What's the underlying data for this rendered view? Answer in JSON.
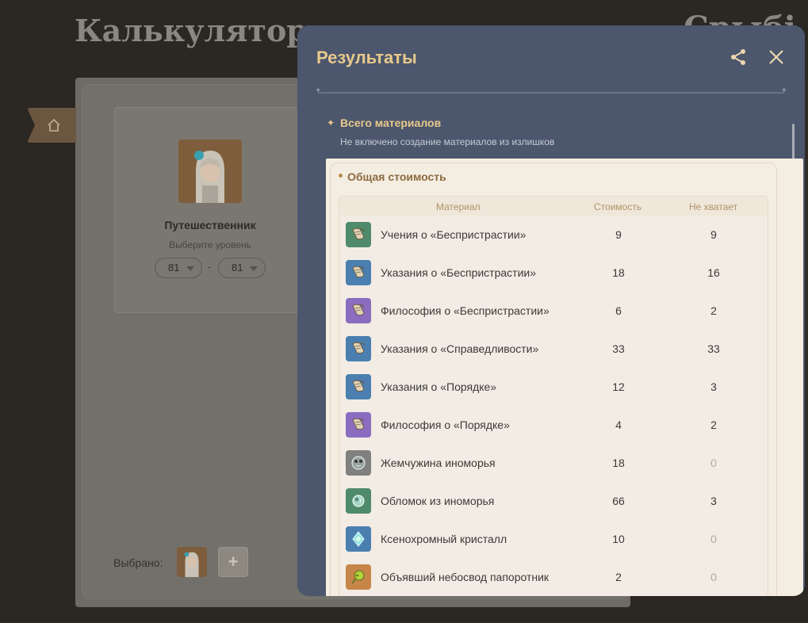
{
  "background": {
    "title": "Калькулятор м",
    "title_right": "Срыбі",
    "character": {
      "name": "Путешественник",
      "level_prompt": "Выберите уровень",
      "level_from": "81",
      "level_to": "81",
      "dash": "-"
    },
    "selected_label": "Выбрано:",
    "add_label": "+"
  },
  "modal": {
    "title": "Результаты",
    "section_title": "Всего материалов",
    "section_subtitle": "Не включено создание материалов из излишков",
    "cost_title": "Общая стоимость",
    "columns": {
      "material": "Материал",
      "cost": "Стоимость",
      "missing": "Не хватает"
    },
    "rows": [
      {
        "name": "Учения о «Беспристрастии»",
        "cost": "9",
        "missing": "9",
        "quality": "green",
        "icon": "scroll-icon"
      },
      {
        "name": "Указания о «Беспристрастии»",
        "cost": "18",
        "missing": "16",
        "quality": "blue",
        "icon": "scroll-icon"
      },
      {
        "name": "Философия о «Беспристрастии»",
        "cost": "6",
        "missing": "2",
        "quality": "purple",
        "icon": "scroll-icon"
      },
      {
        "name": "Указания о «Справедливости»",
        "cost": "33",
        "missing": "33",
        "quality": "blue",
        "icon": "scroll-icon"
      },
      {
        "name": "Указания о «Порядке»",
        "cost": "12",
        "missing": "3",
        "quality": "blue",
        "icon": "scroll-icon"
      },
      {
        "name": "Философия о «Порядке»",
        "cost": "4",
        "missing": "2",
        "quality": "purple",
        "icon": "scroll-icon"
      },
      {
        "name": "Жемчужина иноморья",
        "cost": "18",
        "missing": "0",
        "quality": "gray",
        "icon": "pearl-icon"
      },
      {
        "name": "Обломок из иноморья",
        "cost": "66",
        "missing": "3",
        "quality": "green",
        "icon": "shard-icon"
      },
      {
        "name": "Ксенохромный кристалл",
        "cost": "10",
        "missing": "0",
        "quality": "blue",
        "icon": "crystal-icon"
      },
      {
        "name": "Объявший небосвод папоротник",
        "cost": "2",
        "missing": "0",
        "quality": "orange",
        "icon": "fern-icon"
      }
    ]
  },
  "colors": {
    "modal_bg": "#4c566c",
    "accent_gold": "#e8c98c",
    "panel_bg": "#f4ede2"
  }
}
